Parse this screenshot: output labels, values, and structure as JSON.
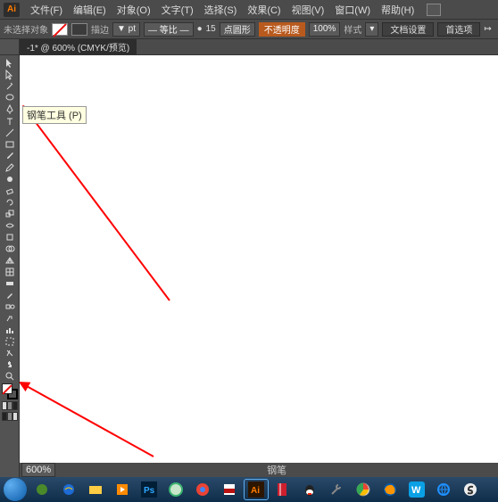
{
  "logo": "Ai",
  "menu": [
    "文件(F)",
    "编辑(E)",
    "对象(O)",
    "文字(T)",
    "选择(S)",
    "效果(C)",
    "视图(V)",
    "窗口(W)",
    "帮助(H)"
  ],
  "optbar": {
    "no_selection": "未选择对象",
    "stroke_val": "",
    "arrow_r": "▸",
    "stroke_lbl": "描边",
    "pt": "▼ pt",
    "pt_dd": "▾",
    "uniform": "— 等比 —",
    "dot_r": "●",
    "num": "15",
    "basic": "点圆形",
    "dd2": "▾",
    "opacity_lbl": "不透明度",
    "opacity_val": "100%",
    "dd3": "▾",
    "style_lbl": "样式",
    "dd4": "▾",
    "doc_setup": "文档设置",
    "prefs": "首选项",
    "align": "↦"
  },
  "doc_tab": "-1* @ 600% (CMYK/预览)",
  "tooltip": "钢笔工具 (P)",
  "zoom": "600%",
  "scroll_label": "钢笔",
  "colors": {
    "swirl": "#4a8a2a",
    "ie": "#1e6bd6",
    "folder": "#ffcc44",
    "media": "#ff8a00",
    "ps": "#001e36",
    "ps_fg": "#31a8ff",
    "green": "#3cb371",
    "chrome": "#ea4335",
    "pdf": "#b11",
    "ai": "#ff7c00",
    "qq": "#e21",
    "reader": "#cd1f2d",
    "tools": "#555",
    "chromeb": "#fbbc05",
    "ff": "#ff9500",
    "box": "#0aa0e6",
    "globe": "#1e90ff",
    "sogou": "#333"
  }
}
